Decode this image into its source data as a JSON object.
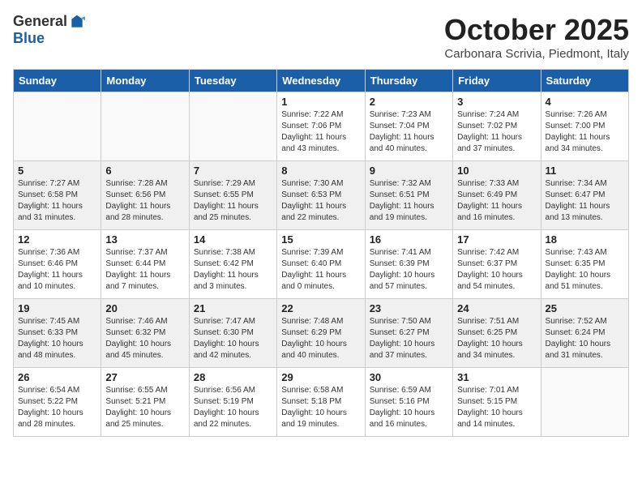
{
  "logo": {
    "general": "General",
    "blue": "Blue"
  },
  "title": "October 2025",
  "subtitle": "Carbonara Scrivia, Piedmont, Italy",
  "days_of_week": [
    "Sunday",
    "Monday",
    "Tuesday",
    "Wednesday",
    "Thursday",
    "Friday",
    "Saturday"
  ],
  "weeks": [
    {
      "shaded": false,
      "days": [
        {
          "num": "",
          "info": ""
        },
        {
          "num": "",
          "info": ""
        },
        {
          "num": "",
          "info": ""
        },
        {
          "num": "1",
          "info": "Sunrise: 7:22 AM\nSunset: 7:06 PM\nDaylight: 11 hours and 43 minutes."
        },
        {
          "num": "2",
          "info": "Sunrise: 7:23 AM\nSunset: 7:04 PM\nDaylight: 11 hours and 40 minutes."
        },
        {
          "num": "3",
          "info": "Sunrise: 7:24 AM\nSunset: 7:02 PM\nDaylight: 11 hours and 37 minutes."
        },
        {
          "num": "4",
          "info": "Sunrise: 7:26 AM\nSunset: 7:00 PM\nDaylight: 11 hours and 34 minutes."
        }
      ]
    },
    {
      "shaded": true,
      "days": [
        {
          "num": "5",
          "info": "Sunrise: 7:27 AM\nSunset: 6:58 PM\nDaylight: 11 hours and 31 minutes."
        },
        {
          "num": "6",
          "info": "Sunrise: 7:28 AM\nSunset: 6:56 PM\nDaylight: 11 hours and 28 minutes."
        },
        {
          "num": "7",
          "info": "Sunrise: 7:29 AM\nSunset: 6:55 PM\nDaylight: 11 hours and 25 minutes."
        },
        {
          "num": "8",
          "info": "Sunrise: 7:30 AM\nSunset: 6:53 PM\nDaylight: 11 hours and 22 minutes."
        },
        {
          "num": "9",
          "info": "Sunrise: 7:32 AM\nSunset: 6:51 PM\nDaylight: 11 hours and 19 minutes."
        },
        {
          "num": "10",
          "info": "Sunrise: 7:33 AM\nSunset: 6:49 PM\nDaylight: 11 hours and 16 minutes."
        },
        {
          "num": "11",
          "info": "Sunrise: 7:34 AM\nSunset: 6:47 PM\nDaylight: 11 hours and 13 minutes."
        }
      ]
    },
    {
      "shaded": false,
      "days": [
        {
          "num": "12",
          "info": "Sunrise: 7:36 AM\nSunset: 6:46 PM\nDaylight: 11 hours and 10 minutes."
        },
        {
          "num": "13",
          "info": "Sunrise: 7:37 AM\nSunset: 6:44 PM\nDaylight: 11 hours and 7 minutes."
        },
        {
          "num": "14",
          "info": "Sunrise: 7:38 AM\nSunset: 6:42 PM\nDaylight: 11 hours and 3 minutes."
        },
        {
          "num": "15",
          "info": "Sunrise: 7:39 AM\nSunset: 6:40 PM\nDaylight: 11 hours and 0 minutes."
        },
        {
          "num": "16",
          "info": "Sunrise: 7:41 AM\nSunset: 6:39 PM\nDaylight: 10 hours and 57 minutes."
        },
        {
          "num": "17",
          "info": "Sunrise: 7:42 AM\nSunset: 6:37 PM\nDaylight: 10 hours and 54 minutes."
        },
        {
          "num": "18",
          "info": "Sunrise: 7:43 AM\nSunset: 6:35 PM\nDaylight: 10 hours and 51 minutes."
        }
      ]
    },
    {
      "shaded": true,
      "days": [
        {
          "num": "19",
          "info": "Sunrise: 7:45 AM\nSunset: 6:33 PM\nDaylight: 10 hours and 48 minutes."
        },
        {
          "num": "20",
          "info": "Sunrise: 7:46 AM\nSunset: 6:32 PM\nDaylight: 10 hours and 45 minutes."
        },
        {
          "num": "21",
          "info": "Sunrise: 7:47 AM\nSunset: 6:30 PM\nDaylight: 10 hours and 42 minutes."
        },
        {
          "num": "22",
          "info": "Sunrise: 7:48 AM\nSunset: 6:29 PM\nDaylight: 10 hours and 40 minutes."
        },
        {
          "num": "23",
          "info": "Sunrise: 7:50 AM\nSunset: 6:27 PM\nDaylight: 10 hours and 37 minutes."
        },
        {
          "num": "24",
          "info": "Sunrise: 7:51 AM\nSunset: 6:25 PM\nDaylight: 10 hours and 34 minutes."
        },
        {
          "num": "25",
          "info": "Sunrise: 7:52 AM\nSunset: 6:24 PM\nDaylight: 10 hours and 31 minutes."
        }
      ]
    },
    {
      "shaded": false,
      "days": [
        {
          "num": "26",
          "info": "Sunrise: 6:54 AM\nSunset: 5:22 PM\nDaylight: 10 hours and 28 minutes."
        },
        {
          "num": "27",
          "info": "Sunrise: 6:55 AM\nSunset: 5:21 PM\nDaylight: 10 hours and 25 minutes."
        },
        {
          "num": "28",
          "info": "Sunrise: 6:56 AM\nSunset: 5:19 PM\nDaylight: 10 hours and 22 minutes."
        },
        {
          "num": "29",
          "info": "Sunrise: 6:58 AM\nSunset: 5:18 PM\nDaylight: 10 hours and 19 minutes."
        },
        {
          "num": "30",
          "info": "Sunrise: 6:59 AM\nSunset: 5:16 PM\nDaylight: 10 hours and 16 minutes."
        },
        {
          "num": "31",
          "info": "Sunrise: 7:01 AM\nSunset: 5:15 PM\nDaylight: 10 hours and 14 minutes."
        },
        {
          "num": "",
          "info": ""
        }
      ]
    }
  ]
}
